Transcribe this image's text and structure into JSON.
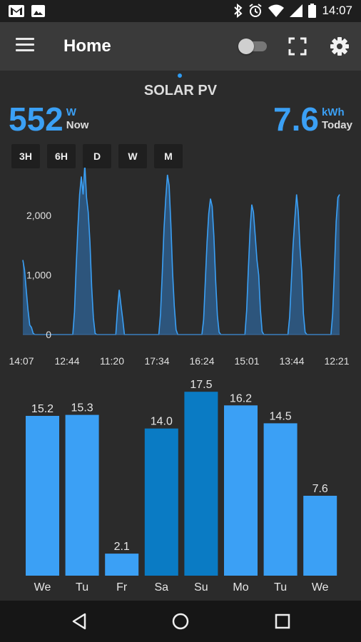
{
  "status_bar": {
    "time": "14:07"
  },
  "app_bar": {
    "title": "Home"
  },
  "dashboard": {
    "title": "SOLAR PV",
    "power_now": {
      "value": "552",
      "unit": "W",
      "label": "Now"
    },
    "energy_today": {
      "value": "7.6",
      "unit": "kWh",
      "label": "Today"
    },
    "range_buttons": [
      "3H",
      "6H",
      "D",
      "W",
      "M"
    ]
  },
  "colors": {
    "accent": "#3ba0f5",
    "bar": "#3ba0f5",
    "bar_weekend": "#0a7bc4",
    "area_fill": "#2d5a85"
  },
  "chart_data": [
    {
      "type": "area",
      "y_ticks": [
        "2,000",
        "1,000",
        "0"
      ],
      "ylim": [
        0,
        2800
      ],
      "x_labels": [
        "14:07",
        "12:44",
        "11:20",
        "17:34",
        "16:24",
        "15:01",
        "13:44",
        "12:21"
      ],
      "series": [
        {
          "values": [
            1250,
            1080,
            750,
            420,
            160,
            120,
            20,
            0,
            0,
            0,
            0,
            0,
            0,
            0,
            0,
            0,
            0,
            0,
            0,
            0,
            0,
            0,
            0,
            0,
            0,
            0,
            0,
            0,
            0,
            0,
            380,
            1150,
            1800,
            2350,
            2650,
            2350,
            2850,
            2300,
            2050,
            1550,
            800,
            280,
            20,
            0,
            0,
            0,
            0,
            0,
            0,
            0,
            0,
            0,
            0,
            0,
            0,
            420,
            750,
            500,
            260,
            0,
            0,
            0,
            0,
            0,
            0,
            0,
            0,
            0,
            0,
            0,
            0,
            0,
            0,
            0,
            0,
            0,
            0,
            0,
            0,
            0,
            350,
            1050,
            1780,
            2280,
            2680,
            2500,
            1850,
            1050,
            480,
            80,
            0,
            0,
            0,
            0,
            0,
            0,
            0,
            0,
            0,
            0,
            0,
            0,
            0,
            0,
            0,
            250,
            900,
            1550,
            2030,
            2280,
            2150,
            1650,
            900,
            320,
            40,
            0,
            0,
            0,
            0,
            0,
            0,
            0,
            0,
            0,
            0,
            0,
            0,
            0,
            0,
            0,
            400,
            1100,
            1750,
            2180,
            2050,
            1650,
            1250,
            1000,
            420,
            50,
            0,
            0,
            0,
            0,
            0,
            0,
            0,
            0,
            0,
            0,
            0,
            0,
            0,
            0,
            0,
            300,
            900,
            1500,
            1950,
            2350,
            2050,
            1450,
            1050,
            350,
            40,
            0,
            0,
            0,
            0,
            0,
            0,
            0,
            0,
            0,
            0,
            0,
            0,
            0,
            0,
            0,
            350,
            1100,
            1900,
            2300,
            2350
          ]
        }
      ]
    },
    {
      "type": "bar",
      "categories": [
        "We",
        "Tu",
        "Fr",
        "Sa",
        "Su",
        "Mo",
        "Tu",
        "We"
      ],
      "values": [
        15.2,
        15.3,
        2.1,
        14.0,
        17.5,
        16.2,
        14.5,
        7.6
      ],
      "value_labels": [
        "15.2",
        "15.3",
        "2.1",
        "14.0",
        "17.5",
        "16.2",
        "14.5",
        "7.6"
      ],
      "weekend": [
        false,
        false,
        false,
        true,
        true,
        false,
        false,
        false
      ],
      "ylim": [
        0,
        18.8
      ]
    }
  ]
}
